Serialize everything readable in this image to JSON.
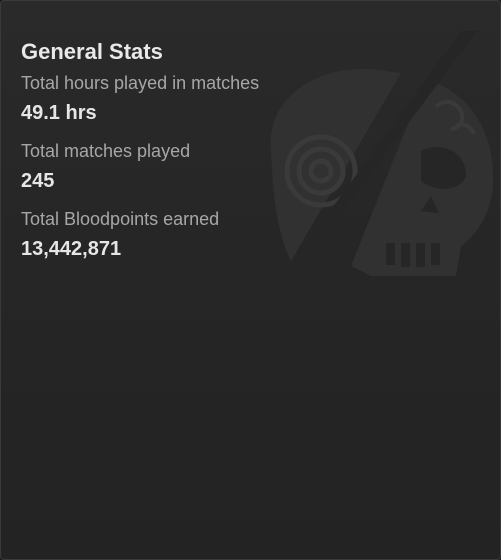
{
  "card": {
    "title": "General Stats",
    "emblem_icon": "cracked-skull-emblem",
    "stats": [
      {
        "label": "Total hours played in matches",
        "value": "49.1 hrs"
      },
      {
        "label": "Total matches played",
        "value": "245"
      },
      {
        "label": "Total Bloodpoints earned",
        "value": "13,442,871"
      }
    ]
  },
  "colors": {
    "background": "#262626",
    "title_text": "#e9e9e9",
    "label_text": "#a7a7a7",
    "value_text": "#e6e6e6",
    "emblem": "#333333"
  }
}
